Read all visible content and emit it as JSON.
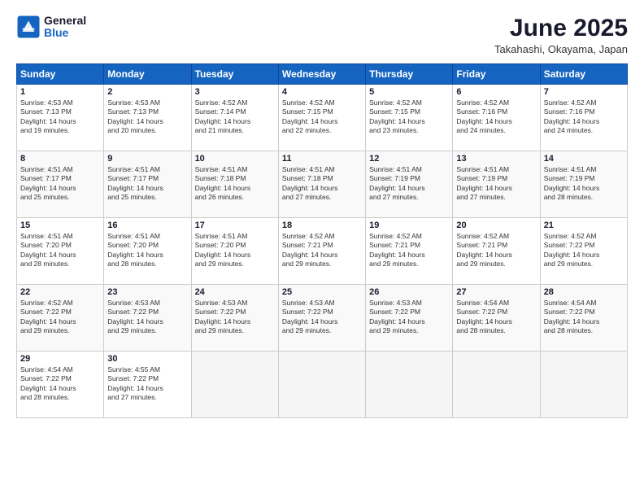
{
  "logo": {
    "line1": "General",
    "line2": "Blue"
  },
  "title": "June 2025",
  "subtitle": "Takahashi, Okayama, Japan",
  "headers": [
    "Sunday",
    "Monday",
    "Tuesday",
    "Wednesday",
    "Thursday",
    "Friday",
    "Saturday"
  ],
  "weeks": [
    [
      {
        "day": "1",
        "lines": [
          "Sunrise: 4:53 AM",
          "Sunset: 7:13 PM",
          "Daylight: 14 hours",
          "and 19 minutes."
        ]
      },
      {
        "day": "2",
        "lines": [
          "Sunrise: 4:53 AM",
          "Sunset: 7:13 PM",
          "Daylight: 14 hours",
          "and 20 minutes."
        ]
      },
      {
        "day": "3",
        "lines": [
          "Sunrise: 4:52 AM",
          "Sunset: 7:14 PM",
          "Daylight: 14 hours",
          "and 21 minutes."
        ]
      },
      {
        "day": "4",
        "lines": [
          "Sunrise: 4:52 AM",
          "Sunset: 7:15 PM",
          "Daylight: 14 hours",
          "and 22 minutes."
        ]
      },
      {
        "day": "5",
        "lines": [
          "Sunrise: 4:52 AM",
          "Sunset: 7:15 PM",
          "Daylight: 14 hours",
          "and 23 minutes."
        ]
      },
      {
        "day": "6",
        "lines": [
          "Sunrise: 4:52 AM",
          "Sunset: 7:16 PM",
          "Daylight: 14 hours",
          "and 24 minutes."
        ]
      },
      {
        "day": "7",
        "lines": [
          "Sunrise: 4:52 AM",
          "Sunset: 7:16 PM",
          "Daylight: 14 hours",
          "and 24 minutes."
        ]
      }
    ],
    [
      {
        "day": "8",
        "lines": [
          "Sunrise: 4:51 AM",
          "Sunset: 7:17 PM",
          "Daylight: 14 hours",
          "and 25 minutes."
        ]
      },
      {
        "day": "9",
        "lines": [
          "Sunrise: 4:51 AM",
          "Sunset: 7:17 PM",
          "Daylight: 14 hours",
          "and 25 minutes."
        ]
      },
      {
        "day": "10",
        "lines": [
          "Sunrise: 4:51 AM",
          "Sunset: 7:18 PM",
          "Daylight: 14 hours",
          "and 26 minutes."
        ]
      },
      {
        "day": "11",
        "lines": [
          "Sunrise: 4:51 AM",
          "Sunset: 7:18 PM",
          "Daylight: 14 hours",
          "and 27 minutes."
        ]
      },
      {
        "day": "12",
        "lines": [
          "Sunrise: 4:51 AM",
          "Sunset: 7:19 PM",
          "Daylight: 14 hours",
          "and 27 minutes."
        ]
      },
      {
        "day": "13",
        "lines": [
          "Sunrise: 4:51 AM",
          "Sunset: 7:19 PM",
          "Daylight: 14 hours",
          "and 27 minutes."
        ]
      },
      {
        "day": "14",
        "lines": [
          "Sunrise: 4:51 AM",
          "Sunset: 7:19 PM",
          "Daylight: 14 hours",
          "and 28 minutes."
        ]
      }
    ],
    [
      {
        "day": "15",
        "lines": [
          "Sunrise: 4:51 AM",
          "Sunset: 7:20 PM",
          "Daylight: 14 hours",
          "and 28 minutes."
        ]
      },
      {
        "day": "16",
        "lines": [
          "Sunrise: 4:51 AM",
          "Sunset: 7:20 PM",
          "Daylight: 14 hours",
          "and 28 minutes."
        ]
      },
      {
        "day": "17",
        "lines": [
          "Sunrise: 4:51 AM",
          "Sunset: 7:20 PM",
          "Daylight: 14 hours",
          "and 29 minutes."
        ]
      },
      {
        "day": "18",
        "lines": [
          "Sunrise: 4:52 AM",
          "Sunset: 7:21 PM",
          "Daylight: 14 hours",
          "and 29 minutes."
        ]
      },
      {
        "day": "19",
        "lines": [
          "Sunrise: 4:52 AM",
          "Sunset: 7:21 PM",
          "Daylight: 14 hours",
          "and 29 minutes."
        ]
      },
      {
        "day": "20",
        "lines": [
          "Sunrise: 4:52 AM",
          "Sunset: 7:21 PM",
          "Daylight: 14 hours",
          "and 29 minutes."
        ]
      },
      {
        "day": "21",
        "lines": [
          "Sunrise: 4:52 AM",
          "Sunset: 7:22 PM",
          "Daylight: 14 hours",
          "and 29 minutes."
        ]
      }
    ],
    [
      {
        "day": "22",
        "lines": [
          "Sunrise: 4:52 AM",
          "Sunset: 7:22 PM",
          "Daylight: 14 hours",
          "and 29 minutes."
        ]
      },
      {
        "day": "23",
        "lines": [
          "Sunrise: 4:53 AM",
          "Sunset: 7:22 PM",
          "Daylight: 14 hours",
          "and 29 minutes."
        ]
      },
      {
        "day": "24",
        "lines": [
          "Sunrise: 4:53 AM",
          "Sunset: 7:22 PM",
          "Daylight: 14 hours",
          "and 29 minutes."
        ]
      },
      {
        "day": "25",
        "lines": [
          "Sunrise: 4:53 AM",
          "Sunset: 7:22 PM",
          "Daylight: 14 hours",
          "and 29 minutes."
        ]
      },
      {
        "day": "26",
        "lines": [
          "Sunrise: 4:53 AM",
          "Sunset: 7:22 PM",
          "Daylight: 14 hours",
          "and 29 minutes."
        ]
      },
      {
        "day": "27",
        "lines": [
          "Sunrise: 4:54 AM",
          "Sunset: 7:22 PM",
          "Daylight: 14 hours",
          "and 28 minutes."
        ]
      },
      {
        "day": "28",
        "lines": [
          "Sunrise: 4:54 AM",
          "Sunset: 7:22 PM",
          "Daylight: 14 hours",
          "and 28 minutes."
        ]
      }
    ],
    [
      {
        "day": "29",
        "lines": [
          "Sunrise: 4:54 AM",
          "Sunset: 7:22 PM",
          "Daylight: 14 hours",
          "and 28 minutes."
        ]
      },
      {
        "day": "30",
        "lines": [
          "Sunrise: 4:55 AM",
          "Sunset: 7:22 PM",
          "Daylight: 14 hours",
          "and 27 minutes."
        ]
      },
      {
        "day": "",
        "lines": []
      },
      {
        "day": "",
        "lines": []
      },
      {
        "day": "",
        "lines": []
      },
      {
        "day": "",
        "lines": []
      },
      {
        "day": "",
        "lines": []
      }
    ]
  ]
}
